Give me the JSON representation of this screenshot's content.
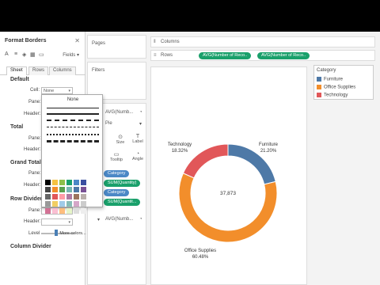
{
  "format_pane": {
    "title": "Format Borders",
    "close_icon": "close-icon",
    "tools": [
      "font-icon",
      "align-icon",
      "shading-icon",
      "borders-icon",
      "lines-icon"
    ],
    "fields_label": "Fields",
    "tabs": [
      "Sheet",
      "Rows",
      "Columns"
    ],
    "default_title": "Default",
    "cell_label": "Cell:",
    "cell_value": "None",
    "pane_label": "Pane:",
    "header_label": "Header:",
    "total_title": "Total",
    "total_pane_label": "Pane:",
    "total_header_label": "Header:",
    "grand_total_title": "Grand Total",
    "grand_pane_label": "Pane:",
    "grand_header_label": "Header:",
    "row_divider_title": "Row Divider",
    "rd_pane_label": "Pane:",
    "rd_header_label": "Header:",
    "level_label": "Level",
    "column_divider_title": "Column Divider"
  },
  "border_popup": {
    "none_label": "None",
    "more_colors_label": "More colors...",
    "swatch_colors": [
      "#000000",
      "#f5c242",
      "#8dbf4a",
      "#1aa06b",
      "#4b88c6",
      "#3a4fa0",
      "#444444",
      "#f28e2b",
      "#59a14f",
      "#76b7b2",
      "#4e79a7",
      "#7a5195",
      "#666666",
      "#e15759",
      "#ff9da7",
      "#b07aa1",
      "#9c755f",
      "#bab0ac",
      "#999999",
      "#f1ce63",
      "#a0cbe8",
      "#86bcb6",
      "#d4a6c8",
      "#cccccc",
      "#d37295",
      "#fabfd2",
      "#ffbe7d",
      "#e6f5c9",
      "#dddddd",
      "#eeeeee"
    ]
  },
  "shelves": {
    "pages_label": "Pages",
    "filters_label": "Filters",
    "columns_label": "Columns",
    "rows_label": "Rows",
    "rows_pills": [
      "AVG(Number of Reco..",
      "AVG(Number of Reco.."
    ]
  },
  "marks_card": {
    "measure_label": "AVG(Numb...",
    "measure_label_2": "AVG(Numb...",
    "mark_type": "Pie",
    "size_label": "Size",
    "label_label": "Label",
    "tooltip_label": "Tooltip",
    "angle_label": "Angle",
    "pills": [
      "Category",
      "SUM(Quantity)",
      "Category",
      "SUM(Quantit..."
    ]
  },
  "chart": {
    "center_label": "37,873",
    "colors": {
      "Furniture": "#4e79a7",
      "Office Supplies": "#f28e2b",
      "Technology": "#e15759"
    }
  },
  "chart_data": {
    "type": "pie",
    "categories": [
      "Furniture",
      "Office Supplies",
      "Technology"
    ],
    "values": [
      21.2,
      60.48,
      18.32
    ],
    "value_labels": [
      "21.20%",
      "60.48%",
      "18.32%"
    ],
    "total": "37,873",
    "donut": true,
    "legend": "top-right"
  },
  "legend": {
    "title": "Category",
    "items": [
      "Furniture",
      "Office Supplies",
      "Technology"
    ]
  }
}
